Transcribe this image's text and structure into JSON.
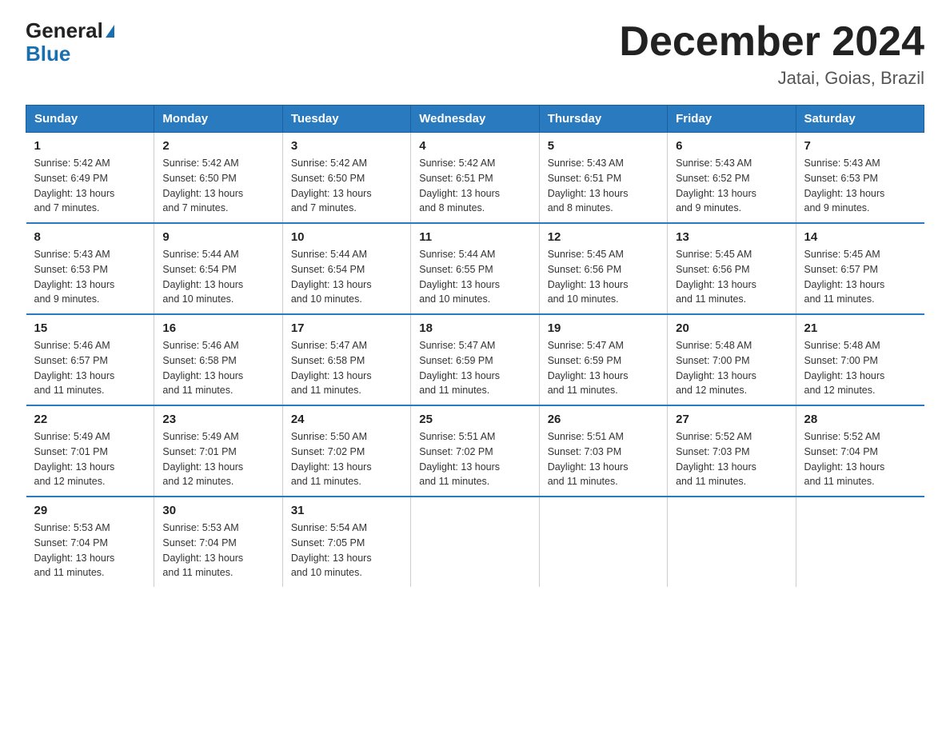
{
  "logo": {
    "general": "General",
    "blue": "Blue",
    "triangle": "▶"
  },
  "title": "December 2024",
  "subtitle": "Jatai, Goias, Brazil",
  "headers": [
    "Sunday",
    "Monday",
    "Tuesday",
    "Wednesday",
    "Thursday",
    "Friday",
    "Saturday"
  ],
  "weeks": [
    [
      {
        "day": "1",
        "info": "Sunrise: 5:42 AM\nSunset: 6:49 PM\nDaylight: 13 hours\nand 7 minutes."
      },
      {
        "day": "2",
        "info": "Sunrise: 5:42 AM\nSunset: 6:50 PM\nDaylight: 13 hours\nand 7 minutes."
      },
      {
        "day": "3",
        "info": "Sunrise: 5:42 AM\nSunset: 6:50 PM\nDaylight: 13 hours\nand 7 minutes."
      },
      {
        "day": "4",
        "info": "Sunrise: 5:42 AM\nSunset: 6:51 PM\nDaylight: 13 hours\nand 8 minutes."
      },
      {
        "day": "5",
        "info": "Sunrise: 5:43 AM\nSunset: 6:51 PM\nDaylight: 13 hours\nand 8 minutes."
      },
      {
        "day": "6",
        "info": "Sunrise: 5:43 AM\nSunset: 6:52 PM\nDaylight: 13 hours\nand 9 minutes."
      },
      {
        "day": "7",
        "info": "Sunrise: 5:43 AM\nSunset: 6:53 PM\nDaylight: 13 hours\nand 9 minutes."
      }
    ],
    [
      {
        "day": "8",
        "info": "Sunrise: 5:43 AM\nSunset: 6:53 PM\nDaylight: 13 hours\nand 9 minutes."
      },
      {
        "day": "9",
        "info": "Sunrise: 5:44 AM\nSunset: 6:54 PM\nDaylight: 13 hours\nand 10 minutes."
      },
      {
        "day": "10",
        "info": "Sunrise: 5:44 AM\nSunset: 6:54 PM\nDaylight: 13 hours\nand 10 minutes."
      },
      {
        "day": "11",
        "info": "Sunrise: 5:44 AM\nSunset: 6:55 PM\nDaylight: 13 hours\nand 10 minutes."
      },
      {
        "day": "12",
        "info": "Sunrise: 5:45 AM\nSunset: 6:56 PM\nDaylight: 13 hours\nand 10 minutes."
      },
      {
        "day": "13",
        "info": "Sunrise: 5:45 AM\nSunset: 6:56 PM\nDaylight: 13 hours\nand 11 minutes."
      },
      {
        "day": "14",
        "info": "Sunrise: 5:45 AM\nSunset: 6:57 PM\nDaylight: 13 hours\nand 11 minutes."
      }
    ],
    [
      {
        "day": "15",
        "info": "Sunrise: 5:46 AM\nSunset: 6:57 PM\nDaylight: 13 hours\nand 11 minutes."
      },
      {
        "day": "16",
        "info": "Sunrise: 5:46 AM\nSunset: 6:58 PM\nDaylight: 13 hours\nand 11 minutes."
      },
      {
        "day": "17",
        "info": "Sunrise: 5:47 AM\nSunset: 6:58 PM\nDaylight: 13 hours\nand 11 minutes."
      },
      {
        "day": "18",
        "info": "Sunrise: 5:47 AM\nSunset: 6:59 PM\nDaylight: 13 hours\nand 11 minutes."
      },
      {
        "day": "19",
        "info": "Sunrise: 5:47 AM\nSunset: 6:59 PM\nDaylight: 13 hours\nand 11 minutes."
      },
      {
        "day": "20",
        "info": "Sunrise: 5:48 AM\nSunset: 7:00 PM\nDaylight: 13 hours\nand 12 minutes."
      },
      {
        "day": "21",
        "info": "Sunrise: 5:48 AM\nSunset: 7:00 PM\nDaylight: 13 hours\nand 12 minutes."
      }
    ],
    [
      {
        "day": "22",
        "info": "Sunrise: 5:49 AM\nSunset: 7:01 PM\nDaylight: 13 hours\nand 12 minutes."
      },
      {
        "day": "23",
        "info": "Sunrise: 5:49 AM\nSunset: 7:01 PM\nDaylight: 13 hours\nand 12 minutes."
      },
      {
        "day": "24",
        "info": "Sunrise: 5:50 AM\nSunset: 7:02 PM\nDaylight: 13 hours\nand 11 minutes."
      },
      {
        "day": "25",
        "info": "Sunrise: 5:51 AM\nSunset: 7:02 PM\nDaylight: 13 hours\nand 11 minutes."
      },
      {
        "day": "26",
        "info": "Sunrise: 5:51 AM\nSunset: 7:03 PM\nDaylight: 13 hours\nand 11 minutes."
      },
      {
        "day": "27",
        "info": "Sunrise: 5:52 AM\nSunset: 7:03 PM\nDaylight: 13 hours\nand 11 minutes."
      },
      {
        "day": "28",
        "info": "Sunrise: 5:52 AM\nSunset: 7:04 PM\nDaylight: 13 hours\nand 11 minutes."
      }
    ],
    [
      {
        "day": "29",
        "info": "Sunrise: 5:53 AM\nSunset: 7:04 PM\nDaylight: 13 hours\nand 11 minutes."
      },
      {
        "day": "30",
        "info": "Sunrise: 5:53 AM\nSunset: 7:04 PM\nDaylight: 13 hours\nand 11 minutes."
      },
      {
        "day": "31",
        "info": "Sunrise: 5:54 AM\nSunset: 7:05 PM\nDaylight: 13 hours\nand 10 minutes."
      },
      {
        "day": "",
        "info": ""
      },
      {
        "day": "",
        "info": ""
      },
      {
        "day": "",
        "info": ""
      },
      {
        "day": "",
        "info": ""
      }
    ]
  ]
}
